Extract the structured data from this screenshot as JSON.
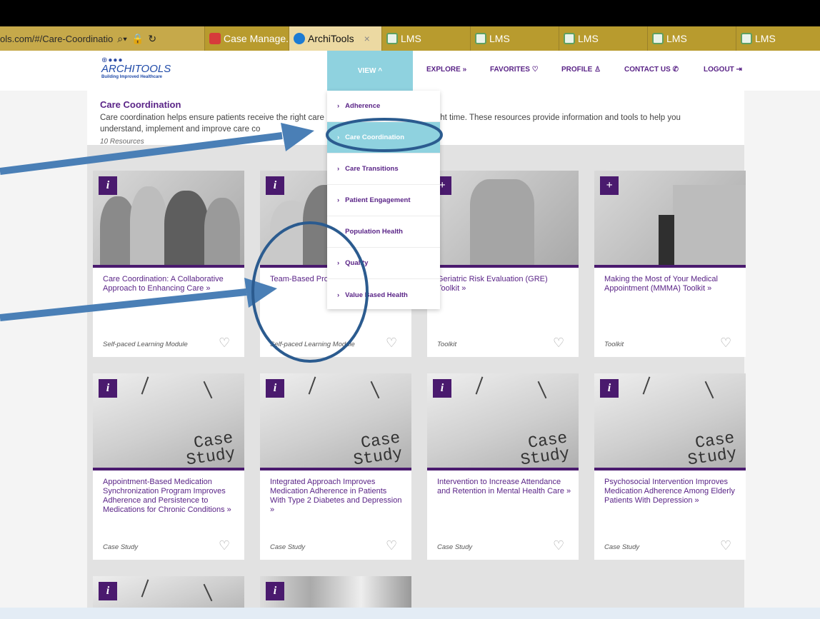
{
  "browser": {
    "url": "ols.com/#/Care-Coordinatio",
    "tabs": [
      {
        "label": "Case Manage...",
        "icon": "case-management-favicon",
        "active": false
      },
      {
        "label": "ArchiTools",
        "icon": "pfizer-favicon",
        "active": true
      },
      {
        "label": "LMS",
        "icon": "lms-favicon",
        "active": false
      },
      {
        "label": "LMS",
        "icon": "lms-favicon",
        "active": false
      },
      {
        "label": "LMS",
        "icon": "lms-favicon",
        "active": false
      },
      {
        "label": "LMS",
        "icon": "lms-favicon",
        "active": false
      },
      {
        "label": "LMS",
        "icon": "lms-favicon",
        "active": false
      }
    ],
    "close_glyph": "×"
  },
  "header": {
    "logo_name": "ARCHITOOLS",
    "logo_tagline": "Building Improved Healthcare",
    "nav": {
      "view": "VIEW ^",
      "explore": "EXPLORE »",
      "favorites": "FAVORITES ♡",
      "profile": "PROFILE ♙",
      "contact": "CONTACT US ✆",
      "logout": "LOGOUT ⇥"
    }
  },
  "intro": {
    "title": "Care Coordination",
    "desc_part1": "Care coordination helps ensure patients receive the right care",
    "desc_part2": "e right time. These resources provide information and tools to help you",
    "desc_line2": "understand, implement and improve care co",
    "count": "10 Resources"
  },
  "dropdown": {
    "items": [
      {
        "label": "Adherence",
        "selected": false
      },
      {
        "label": "Care Coordination",
        "selected": true
      },
      {
        "label": "Care Transitions",
        "selected": false
      },
      {
        "label": "Patient Engagement",
        "selected": false
      },
      {
        "label": "Population Health",
        "selected": false
      },
      {
        "label": "Quality",
        "selected": false
      },
      {
        "label": "Value Based Health",
        "selected": false
      }
    ]
  },
  "cards": [
    {
      "title": "Care Coordination: A Collaborative Approach to Enhancing Care »",
      "type": "Self-paced Learning Module",
      "badge": "i"
    },
    {
      "title": "Team-Based Pro Reach of Health",
      "type": "Self-paced Learning Module",
      "badge": "i"
    },
    {
      "title": "Geriatric Risk Evaluation (GRE) Toolkit »",
      "type": "Toolkit",
      "badge": "+"
    },
    {
      "title": "Making the Most of Your Medical Appointment (MMMA) Toolkit »",
      "type": "Toolkit",
      "badge": "+"
    },
    {
      "title": "Appointment-Based Medication Synchronization Program Improves Adherence and Persistence to Medications for Chronic Conditions »",
      "type": "Case Study",
      "badge": "i",
      "image_text": "Case Study"
    },
    {
      "title": "Integrated Approach Improves Medication Adherence in Patients With Type 2 Diabetes and Depression »",
      "type": "Case Study",
      "badge": "i",
      "image_text": "Case Study"
    },
    {
      "title": "Intervention to Increase Attendance and Retention in Mental Health Care »",
      "type": "Case Study",
      "badge": "i",
      "image_text": "Case Study"
    },
    {
      "title": "Psychosocial Intervention Improves Medication Adherence Among Elderly Patients With Depression »",
      "type": "Case Study",
      "badge": "i",
      "image_text": "Case Study"
    },
    {
      "title": "",
      "type": "",
      "badge": "i"
    },
    {
      "title": "",
      "type": "",
      "badge": "i"
    }
  ],
  "colors": {
    "brand_purple": "#5a2487",
    "accent_teal": "#8fd2df",
    "annotation_blue": "#4a7fb6",
    "tabbar_gold": "#b89b2e"
  }
}
